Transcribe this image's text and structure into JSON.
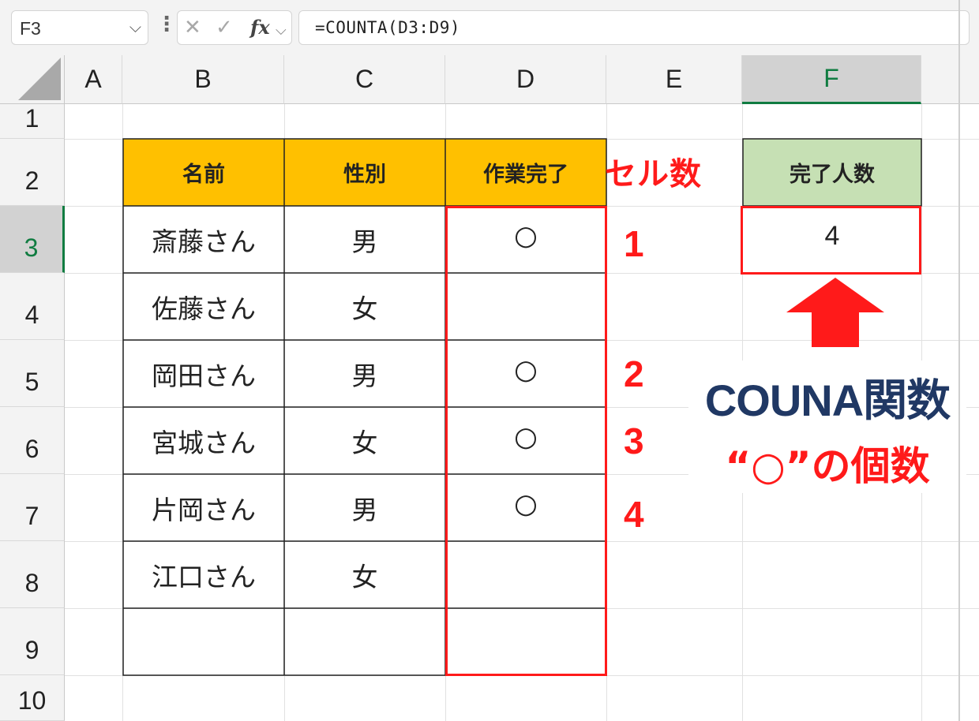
{
  "formula_bar": {
    "name_box": "F3",
    "formula": "=COUNTA(D3:D9)"
  },
  "icons": {
    "cancel": "close-icon",
    "enter": "check-icon",
    "function": "fx-icon"
  },
  "columns": [
    "A",
    "B",
    "C",
    "D",
    "E",
    "F"
  ],
  "rows": [
    "1",
    "2",
    "3",
    "4",
    "5",
    "6",
    "7",
    "8",
    "9",
    "10"
  ],
  "selected_cell": {
    "column": "F",
    "row": "3"
  },
  "table": {
    "headers": [
      "名前",
      "性別",
      "作業完了"
    ],
    "rows": [
      [
        "斎藤さん",
        "男",
        "○"
      ],
      [
        "佐藤さん",
        "女",
        ""
      ],
      [
        "岡田さん",
        "男",
        "○"
      ],
      [
        "宮城さん",
        "女",
        "○"
      ],
      [
        "片岡さん",
        "男",
        "○"
      ],
      [
        "江口さん",
        "女",
        ""
      ],
      [
        "",
        "",
        ""
      ]
    ]
  },
  "result": {
    "header": "完了人数",
    "value": "4"
  },
  "annotations": {
    "cell_count_label": "セル数",
    "counts": [
      "1",
      "2",
      "3",
      "4"
    ],
    "callout_line1": "COUNA関数",
    "callout_line2": "“○”の個数"
  },
  "colors": {
    "table_header": "#ffc000",
    "result_header": "#c6e0b4",
    "highlight": "#ff1a1a",
    "callout_text": "#203864",
    "selection": "#107c41"
  }
}
